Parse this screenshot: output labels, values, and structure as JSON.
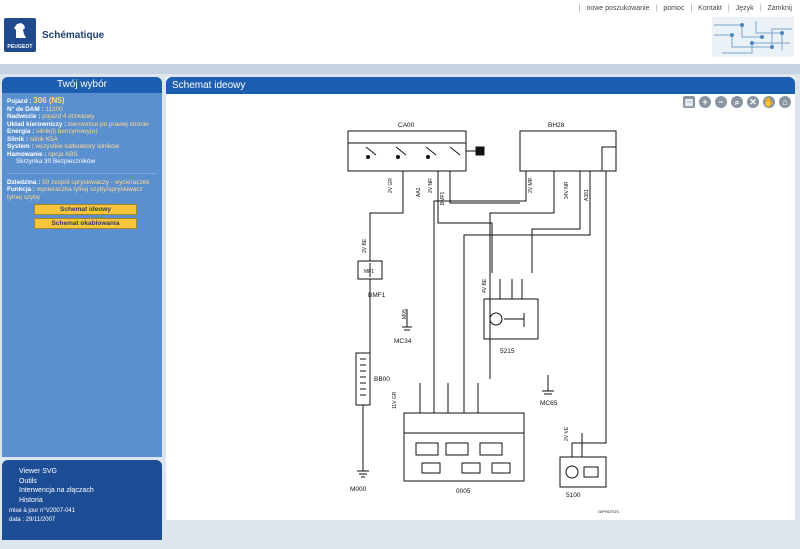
{
  "header": {
    "app_title": "Schématique",
    "brand": "PEUGEOT",
    "links": [
      "nowe poszukowanie",
      "pomoc",
      "Kontakt",
      "Język",
      "Zamknij"
    ]
  },
  "left": {
    "title": "Twój wybór",
    "rows": [
      {
        "label": "Pojazd :",
        "value": "306 (N5)"
      },
      {
        "label": "N° de DAM :",
        "value": "11200"
      },
      {
        "label": "Nadwozie :",
        "value": "pojazd 4 drzwiowy"
      },
      {
        "label": "Układ kierowniczy :",
        "value": "kierownice po prawej stronie"
      },
      {
        "label": "Energia :",
        "value": "silnik(i) benzynowy(e)"
      },
      {
        "label": "Silnik :",
        "value": "silnik K5A"
      },
      {
        "label": "System :",
        "value": "wszystkie kalkulatory silników"
      },
      {
        "label": "Hamowanie :",
        "value": "opcja ABS"
      }
    ],
    "extra": "Skrzynka 30 Bezpieczników",
    "domain_label": "Dziedzina :",
    "domain_value": "50 zespół spryskiwaczy - wycieraczek",
    "function_label": "Funkcja :",
    "function_value": "wycieraczka tylnej szyby/spryskiwacz tylnej szyby",
    "btn1": "Schemat ideowy",
    "btn2": "Schemat okablowania"
  },
  "left_bottom": {
    "items": [
      "Viewer SVG",
      "Outils",
      "Interwencja na złączach",
      "Historia"
    ],
    "update": "mise à jour n°V2007-041",
    "date": "data : 29/11/2007"
  },
  "right": {
    "title": "Schemat ideowy"
  },
  "diagram": {
    "labels": {
      "ca00": "CA00",
      "bh28": "BH28",
      "bmf1": "BMF1",
      "mf1": "MF1",
      "mc34": "MC34",
      "m65": "M65",
      "mc65": "MC65",
      "bb00": "BB00",
      "m000": "M000",
      "c0005": "0005",
      "c5215": "5215",
      "c5100": "5100",
      "v2vgr": "2V GR",
      "v2vbe": "2V BE",
      "v2vnr": "2V NR",
      "v2vmr": "2V MR",
      "v11vgr": "11V GR",
      "v4vbe": "4V BE",
      "v2vve": "2V VE",
      "v34vnr": "34V NR",
      "mf": "MF",
      "aa1": "AA1",
      "bmf1nr": "BMF1",
      "a381": "A381",
      "m05": "M05",
      "vgap": "5100",
      "vgp2": "VE",
      "signature": "GIPHOTUS"
    }
  },
  "colors": {
    "accent_blue": "#1d5eb0",
    "panel_blue": "#5a8fd0",
    "button_yellow": "#f6c53b",
    "value_yellow": "#ffd98a"
  }
}
